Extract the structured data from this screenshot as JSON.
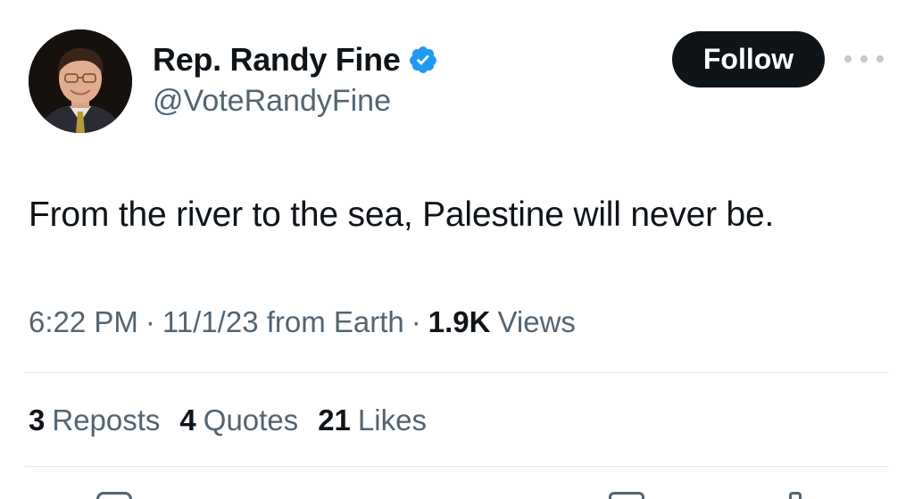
{
  "tweet": {
    "author": {
      "display_name": "Rep. Randy Fine",
      "handle": "@VoteRandyFine",
      "verified": true,
      "verified_icon": "verified-badge-icon",
      "avatar_icon": "profile-photo"
    },
    "follow_label": "Follow",
    "more_icon": "more-options-icon",
    "text": "From the river to the sea, Palestine will never be.",
    "meta": {
      "time": "6:22 PM",
      "date": "11/1/23 from Earth",
      "views_count": "1.9K",
      "views_label": "Views"
    },
    "stats": {
      "reposts_count": "3",
      "reposts_label": "Reposts",
      "quotes_count": "4",
      "quotes_label": "Quotes",
      "likes_count": "21",
      "likes_label": "Likes"
    }
  },
  "colors": {
    "text_primary": "#0f1419",
    "text_secondary": "#536471",
    "verified_blue": "#1d9bf0",
    "button_bg": "#0f1419",
    "divider": "#e6e9eb"
  }
}
